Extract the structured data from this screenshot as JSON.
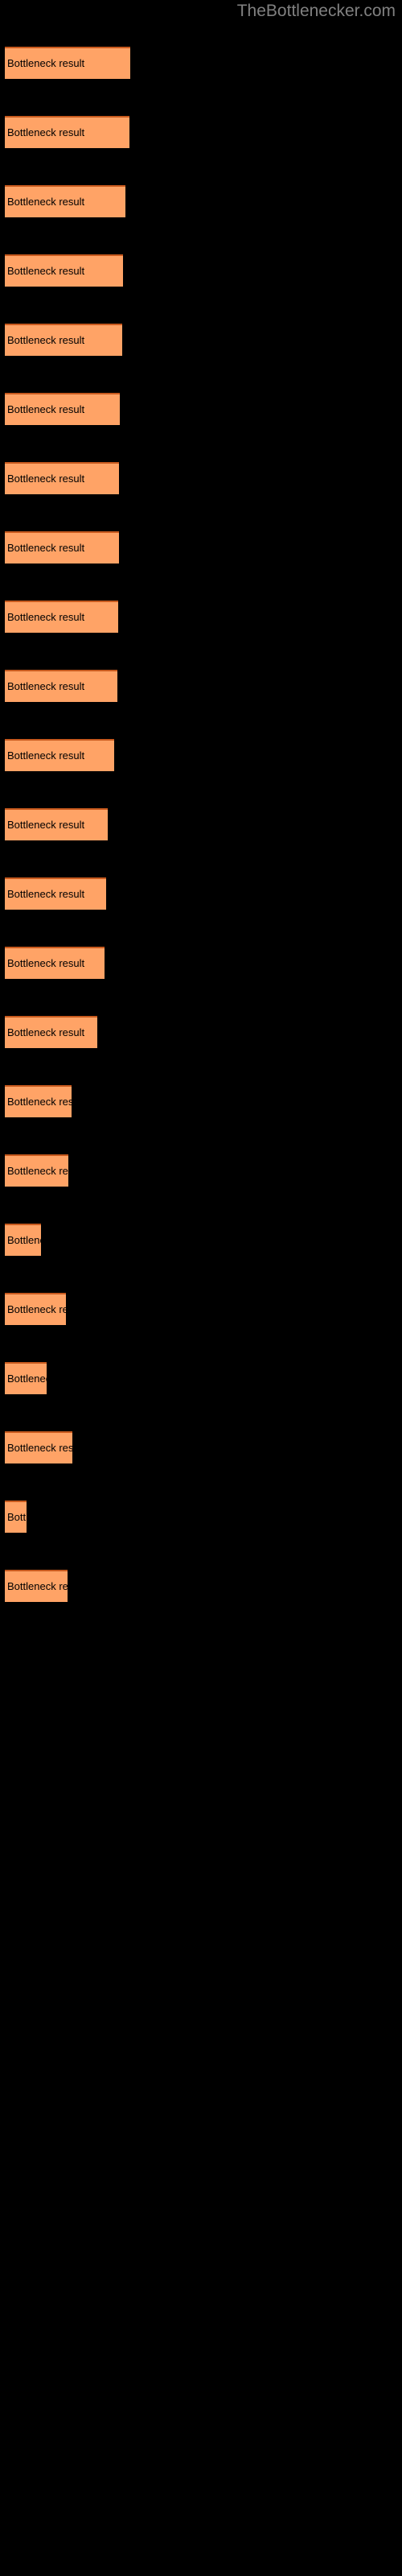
{
  "header": {
    "site_title": "TheBottlenecker.com",
    "title_color": "#808080"
  },
  "colors": {
    "background": "#000000",
    "bar_fill": "#FFA366",
    "bar_border_top": "#C85A1E",
    "bar_label_text": "#000000"
  },
  "chart_data": {
    "type": "bar",
    "orientation": "horizontal",
    "title": "TheBottlenecker.com",
    "xlabel": "",
    "ylabel": "",
    "grid": false,
    "legend": false,
    "bar_label_text": "Bottleneck result",
    "categories": [
      "Bottleneck result",
      "Bottleneck result",
      "Bottleneck result",
      "Bottleneck result",
      "Bottleneck result",
      "Bottleneck result",
      "Bottleneck result",
      "Bottleneck result",
      "Bottleneck result",
      "Bottleneck result",
      "Bottleneck result",
      "Bottleneck result",
      "Bottleneck result",
      "Bottleneck result",
      "Bottleneck result",
      "Bottleneck result",
      "Bottleneck result",
      "Bottleneck result",
      "Bottleneck result",
      "Bottleneck result",
      "Bottleneck result",
      "Bottleneck result",
      "Bottleneck result"
    ],
    "values": [
      156,
      155,
      150,
      147,
      146,
      143,
      142,
      142,
      141,
      140,
      136,
      128,
      126,
      124,
      115,
      83,
      79,
      45,
      76,
      52,
      84,
      27,
      78
    ],
    "xlim": [
      0,
      500
    ],
    "bars": [
      {
        "index": 1,
        "label": "Bottleneck result",
        "width": 156,
        "top": 58
      },
      {
        "index": 2,
        "label": "Bottleneck result",
        "width": 155,
        "top": 144
      },
      {
        "index": 3,
        "label": "Bottleneck result",
        "width": 150,
        "top": 230
      },
      {
        "index": 4,
        "label": "Bottleneck result",
        "width": 147,
        "top": 316
      },
      {
        "index": 5,
        "label": "Bottleneck result",
        "width": 146,
        "top": 402
      },
      {
        "index": 6,
        "label": "Bottleneck result",
        "width": 143,
        "top": 488
      },
      {
        "index": 7,
        "label": "Bottleneck result",
        "width": 142,
        "top": 574
      },
      {
        "index": 8,
        "label": "Bottleneck result",
        "width": 142,
        "top": 660
      },
      {
        "index": 9,
        "label": "Bottleneck result",
        "width": 141,
        "top": 746
      },
      {
        "index": 10,
        "label": "Bottleneck result",
        "width": 140,
        "top": 832
      },
      {
        "index": 11,
        "label": "Bottleneck result",
        "width": 136,
        "top": 918
      },
      {
        "index": 12,
        "label": "Bottleneck result",
        "width": 128,
        "top": 1004
      },
      {
        "index": 13,
        "label": "Bottleneck result",
        "width": 126,
        "top": 1090
      },
      {
        "index": 14,
        "label": "Bottleneck result",
        "width": 124,
        "top": 1176
      },
      {
        "index": 15,
        "label": "Bottleneck result",
        "width": 115,
        "top": 1262
      },
      {
        "index": 16,
        "label": "Bottleneck result",
        "width": 83,
        "top": 1348
      },
      {
        "index": 17,
        "label": "Bottleneck result",
        "width": 79,
        "top": 1434
      },
      {
        "index": 18,
        "label": "Bottleneck result",
        "width": 45,
        "top": 1520
      },
      {
        "index": 19,
        "label": "Bottleneck result",
        "width": 76,
        "top": 1606
      },
      {
        "index": 20,
        "label": "Bottleneck result",
        "width": 52,
        "top": 1692
      },
      {
        "index": 21,
        "label": "Bottleneck result",
        "width": 84,
        "top": 1778
      },
      {
        "index": 22,
        "label": "Bottleneck result",
        "width": 27,
        "top": 1864
      },
      {
        "index": 23,
        "label": "Bottleneck result",
        "width": 78,
        "top": 1950
      }
    ]
  }
}
